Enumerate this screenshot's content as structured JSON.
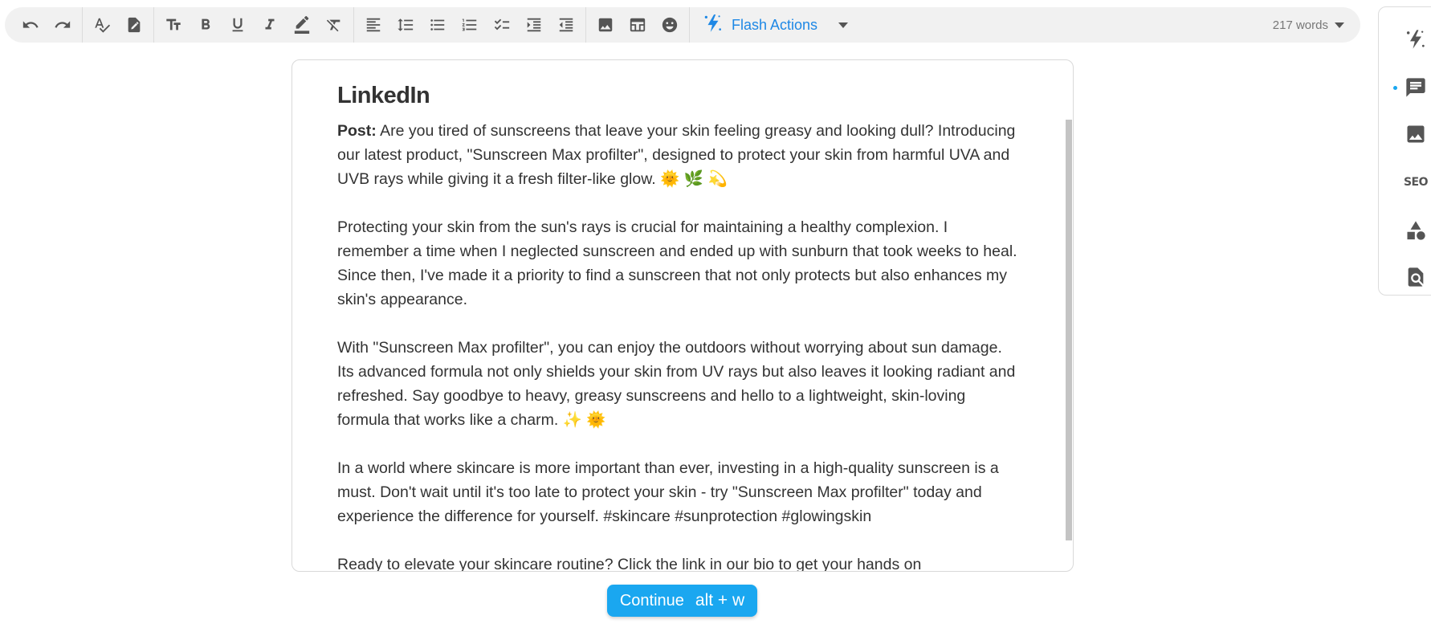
{
  "toolbar": {
    "flash_label": "Flash Actions",
    "word_count": "217 words"
  },
  "editor": {
    "title": "LinkedIn",
    "post_label": "Post:",
    "paragraphs": [
      " Are you tired of sunscreens that leave your skin feeling greasy and looking dull? Introducing our latest product, \"Sunscreen Max profilter\", designed to protect your skin from harmful UVA and UVB rays while giving it a fresh filter-like glow. 🌞 🌿 💫",
      "Protecting your skin from the sun's rays is crucial for maintaining a healthy complexion. I remember a time when I neglected sunscreen and ended up with sunburn that took weeks to heal. Since then, I've made it a priority to find a sunscreen that not only protects but also enhances my skin's appearance.",
      "With \"Sunscreen Max profilter\", you can enjoy the outdoors without worrying about sun damage. Its advanced formula not only shields your skin from UV rays but also leaves it looking radiant and refreshed. Say goodbye to heavy, greasy sunscreens and hello to a lightweight, skin-loving formula that works like a charm. ✨ 🌞",
      "In a world where skincare is more important than ever, investing in a high-quality sunscreen is a must. Don't wait until it's too late to protect your skin - try \"Sunscreen Max profilter\" today and experience the difference for yourself. #skincare #sunprotection #glowingskin",
      "Ready to elevate your skincare routine? Click the link in our bio to get your hands on"
    ]
  },
  "continue_button": {
    "label": "Continue",
    "shortcut": "alt + w"
  },
  "right_panel": {
    "seo_label": "SEO"
  }
}
